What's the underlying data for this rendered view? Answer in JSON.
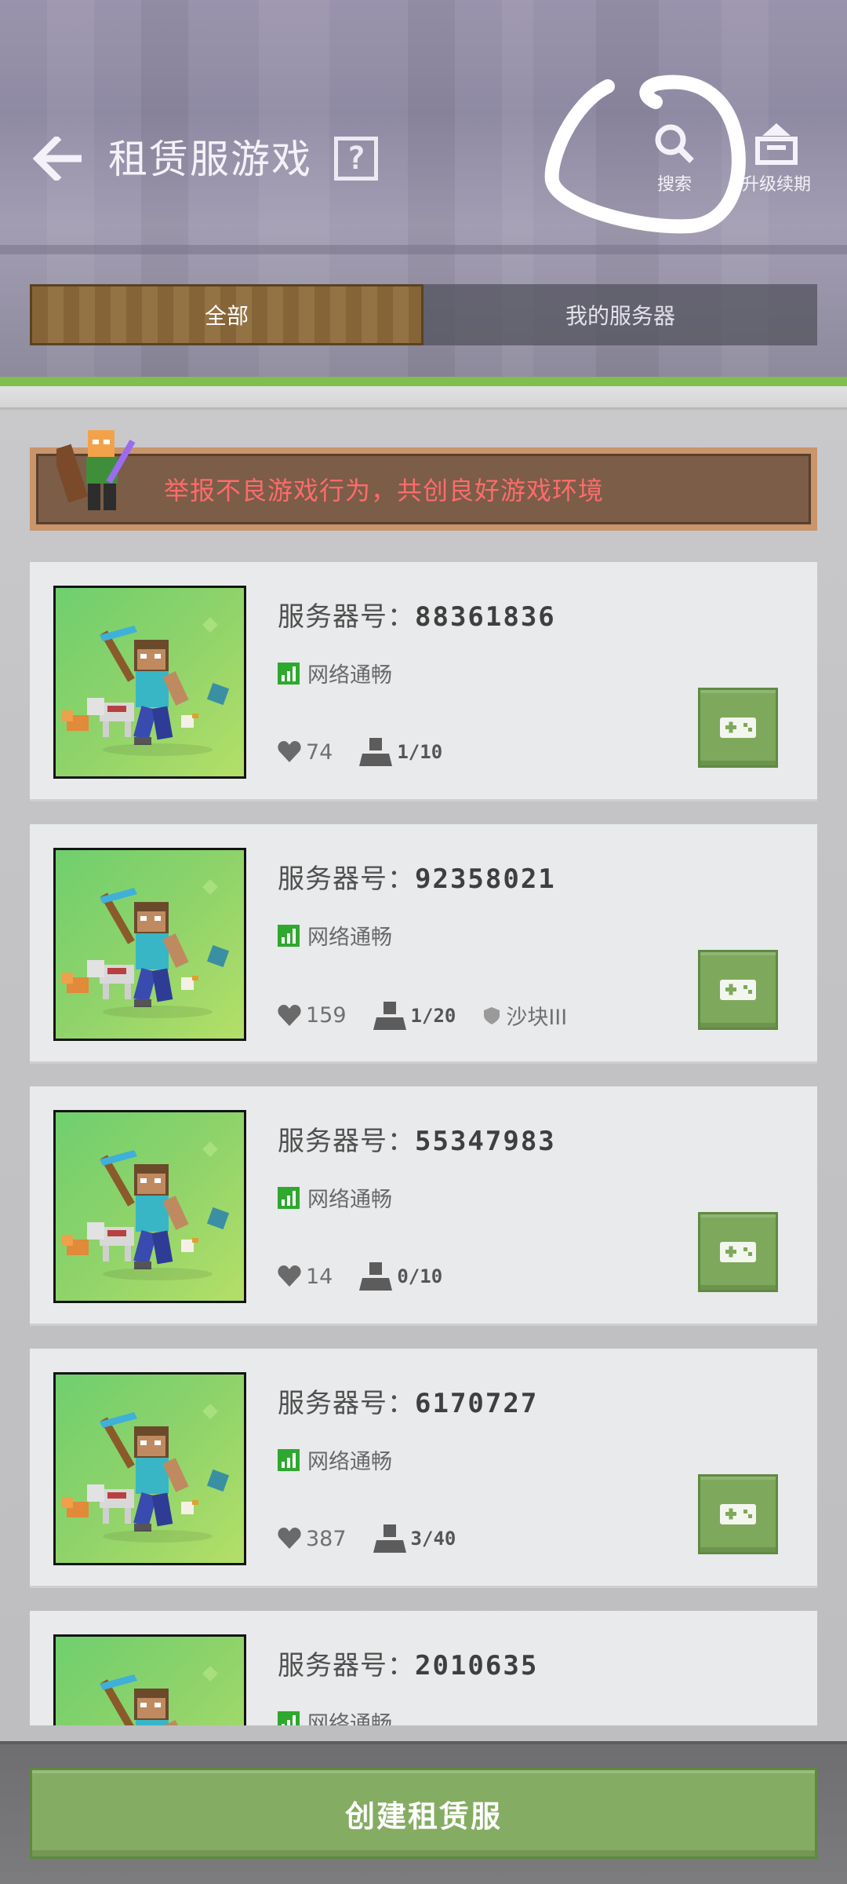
{
  "header": {
    "title": "租赁服游戏",
    "help_label": "?",
    "search_label": "搜索",
    "renew_label": "升级续期"
  },
  "tabs": [
    {
      "label": "全部",
      "active": true
    },
    {
      "label": "我的服务器",
      "active": false
    }
  ],
  "banner": {
    "text": "举报不良游戏行为，共创良好游戏环境",
    "text_color": "#ff6b6b"
  },
  "server_label_prefix": "服务器号：",
  "servers": [
    {
      "id": "88361836",
      "network": "网络通畅",
      "likes": "74",
      "players": "1/10",
      "tag": ""
    },
    {
      "id": "92358021",
      "network": "网络通畅",
      "likes": "159",
      "players": "1/20",
      "tag": "沙块III"
    },
    {
      "id": "55347983",
      "network": "网络通畅",
      "likes": "14",
      "players": "0/10",
      "tag": ""
    },
    {
      "id": "6170727",
      "network": "网络通畅",
      "likes": "387",
      "players": "3/40",
      "tag": ""
    },
    {
      "id": "2010635",
      "network": "网络通畅",
      "likes": "",
      "players": "",
      "tag": ""
    }
  ],
  "footer": {
    "create_label": "创建租赁服"
  },
  "colors": {
    "accent_green": "#84ac62",
    "tab_active": "#8d6a3a",
    "network_green": "#2ea82e"
  },
  "icons": {
    "back": "arrow-left-icon",
    "search": "search-icon",
    "renew": "upgrade-icon",
    "like": "heart-icon",
    "players": "player-icon",
    "network": "signal-icon",
    "play": "gamepad-icon",
    "tag": "shield-icon"
  }
}
